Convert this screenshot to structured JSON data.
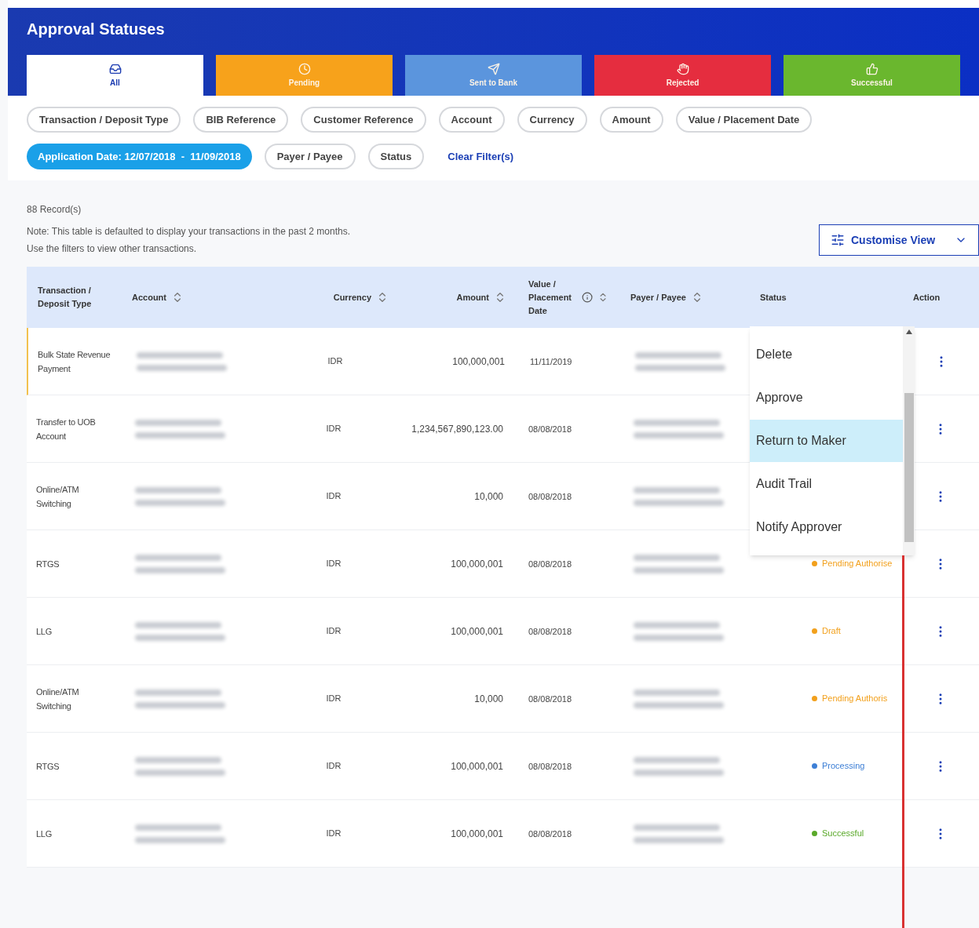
{
  "title": "Approval Statuses",
  "tabs": [
    {
      "label": "All",
      "color": "#ffffff",
      "selected": true
    },
    {
      "label": "Pending",
      "color": "#f7a21b",
      "selected": false
    },
    {
      "label": "Sent to Bank",
      "color": "#5b95dd",
      "selected": false
    },
    {
      "label": "Rejected",
      "color": "#e52d3f",
      "selected": false
    },
    {
      "label": "Successful",
      "color": "#6ab72e",
      "selected": false
    }
  ],
  "filters": [
    {
      "label": "Transaction / Deposit Type",
      "selected": false
    },
    {
      "label": "BIB Reference",
      "selected": false
    },
    {
      "label": "Customer Reference",
      "selected": false
    },
    {
      "label": "Account",
      "selected": false
    },
    {
      "label": "Currency",
      "selected": false
    },
    {
      "label": "Amount",
      "selected": false
    },
    {
      "label": "Value / Placement Date",
      "selected": false
    },
    {
      "label": "Application Date: 12/07/2018  -  11/09/2018",
      "selected": true
    },
    {
      "label": "Payer / Payee",
      "selected": false
    },
    {
      "label": "Status",
      "selected": false
    }
  ],
  "clear_filters": "Clear Filter(s)",
  "records": "88 Record(s)",
  "note": [
    "Note: This table is defaulted to display your transactions in the past 2 months.",
    "Use the filters to view other transactions."
  ],
  "customise_view": "Customise View",
  "columns": [
    {
      "label": "Transaction / Deposit Type",
      "sortable": false
    },
    {
      "label": "Account",
      "sortable": true
    },
    {
      "label": "Currency",
      "sortable": true
    },
    {
      "label": "Amount",
      "sortable": true
    },
    {
      "label": "Value / Placement Date",
      "sortable": true,
      "info": true
    },
    {
      "label": "Payer / Payee",
      "sortable": true
    },
    {
      "label": "Status",
      "sortable": false
    },
    {
      "label": "Action",
      "sortable": false
    }
  ],
  "rows": [
    {
      "type": "Bulk State Revenue Payment",
      "currency": "IDR",
      "amount": "100,000,001",
      "date": "11/11/2019"
    },
    {
      "type": "Transfer to UOB Account",
      "currency": "IDR",
      "amount": "1,234,567,890,123.00",
      "date": "08/08/2018"
    },
    {
      "type": "Online/ATM Switching",
      "currency": "IDR",
      "amount": "10,000",
      "date": "08/08/2018"
    },
    {
      "type": "RTGS",
      "currency": "IDR",
      "amount": "100,000,001",
      "date": "08/08/2018",
      "status": {
        "label": "Pending Authorise",
        "color": "#f2a01c"
      }
    },
    {
      "type": "LLG",
      "currency": "IDR",
      "amount": "100,000,001",
      "date": "08/08/2018",
      "status": {
        "label": "Draft",
        "color": "#f2a01c"
      }
    },
    {
      "type": "Online/ATM Switching",
      "currency": "IDR",
      "amount": "10,000",
      "date": "08/08/2018",
      "status": {
        "label": "Pending Authoris",
        "color": "#f2a01c"
      }
    },
    {
      "type": "RTGS",
      "currency": "IDR",
      "amount": "100,000,001",
      "date": "08/08/2018",
      "status": {
        "label": "Processing",
        "color": "#3d7fd6"
      }
    },
    {
      "type": "LLG",
      "currency": "IDR",
      "amount": "100,000,001",
      "date": "08/08/2018",
      "status": {
        "label": "Successful",
        "color": "#5aa92a"
      }
    }
  ],
  "menu": [
    {
      "label": "Delete",
      "selected": false
    },
    {
      "label": "Approve",
      "selected": false
    },
    {
      "label": "Return to Maker",
      "selected": true
    },
    {
      "label": "Audit Trail",
      "selected": false
    },
    {
      "label": "Notify Approver",
      "selected": false
    }
  ]
}
